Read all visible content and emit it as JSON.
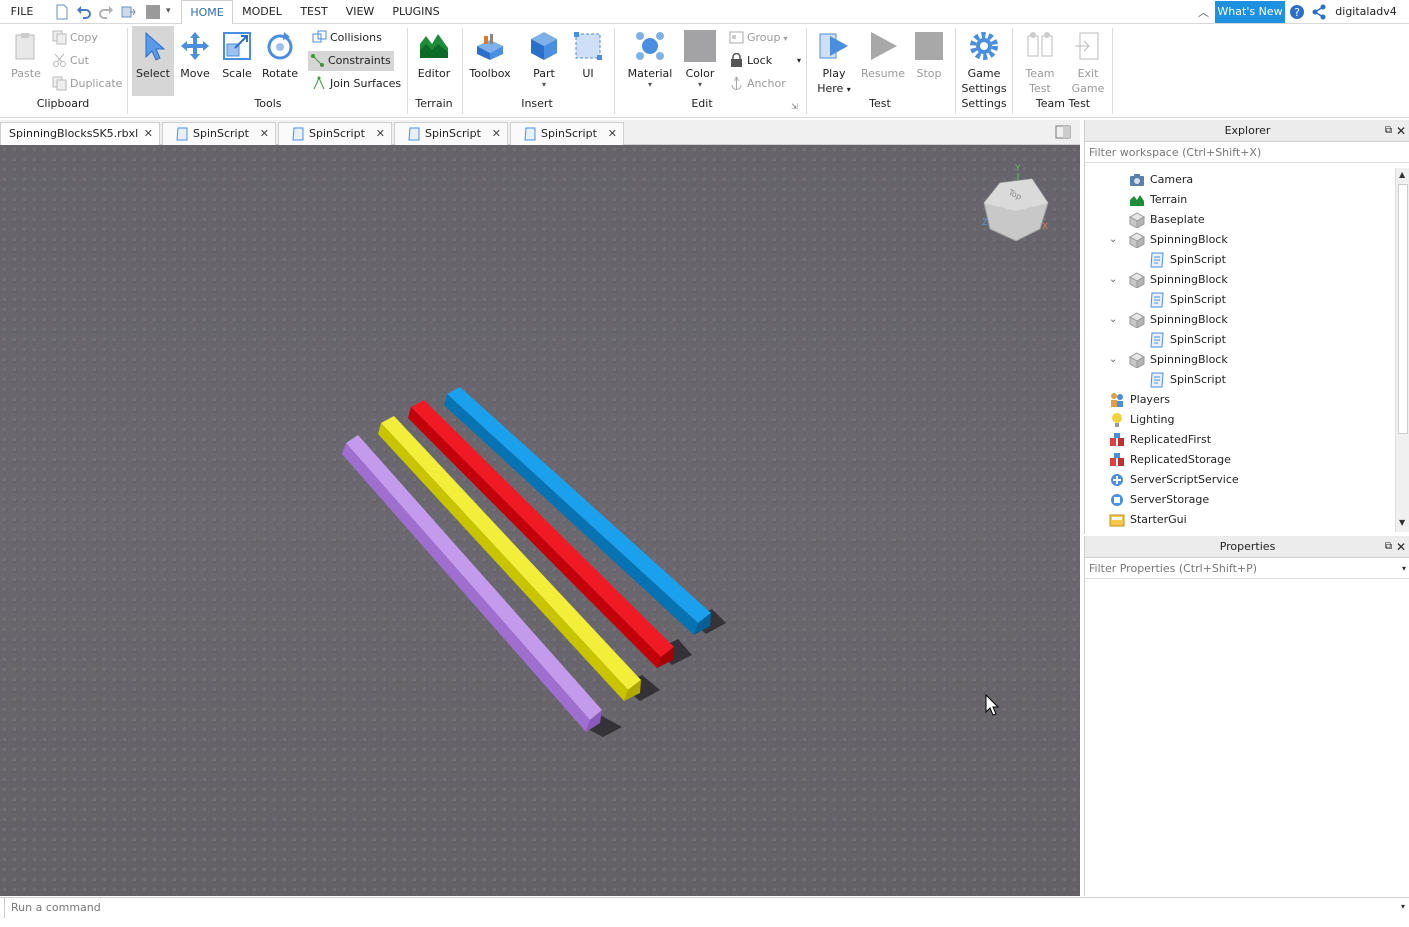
{
  "menubar": {
    "file": "FILE",
    "tabs": [
      "HOME",
      "MODEL",
      "TEST",
      "VIEW",
      "PLUGINS"
    ],
    "whats_new": "What's New",
    "username": "digitaladv4"
  },
  "ribbon": {
    "clipboard": {
      "paste": "Paste",
      "copy": "Copy",
      "cut": "Cut",
      "duplicate": "Duplicate",
      "label": "Clipboard"
    },
    "tools": {
      "select": "Select",
      "move": "Move",
      "scale": "Scale",
      "rotate": "Rotate",
      "collisions": "Collisions",
      "constraints": "Constraints",
      "join_surfaces": "Join Surfaces",
      "label": "Tools"
    },
    "terrain": {
      "editor": "Editor",
      "label": "Terrain"
    },
    "insert": {
      "toolbox": "Toolbox",
      "part": "Part",
      "ui": "UI",
      "label": "Insert"
    },
    "edit": {
      "material": "Material",
      "color": "Color",
      "group": "Group",
      "lock": "Lock",
      "anchor": "Anchor",
      "label": "Edit"
    },
    "test": {
      "play_here_1": "Play",
      "play_here_2": "Here",
      "resume": "Resume",
      "stop": "Stop",
      "label": "Test"
    },
    "settings": {
      "game_settings_1": "Game",
      "game_settings_2": "Settings",
      "label": "Settings"
    },
    "team_test": {
      "team_test_1": "Team",
      "team_test_2": "Test",
      "exit_game_1": "Exit",
      "exit_game_2": "Game",
      "label": "Team Test"
    }
  },
  "doc_tabs": [
    "SpinningBlocksSK5.rbxl",
    "SpinScript",
    "SpinScript",
    "SpinScript",
    "SpinScript"
  ],
  "explorer": {
    "title": "Explorer",
    "filter_placeholder": "Filter workspace (Ctrl+Shift+X)",
    "items": [
      {
        "label": "Camera",
        "icon": "camera-icon"
      },
      {
        "label": "Terrain",
        "icon": "terrain-icon"
      },
      {
        "label": "Baseplate",
        "icon": "part-icon"
      },
      {
        "label": "SpinningBlock",
        "icon": "part-icon"
      },
      {
        "label": "SpinScript",
        "icon": "script-icon"
      },
      {
        "label": "SpinningBlock",
        "icon": "part-icon"
      },
      {
        "label": "SpinScript",
        "icon": "script-icon"
      },
      {
        "label": "SpinningBlock",
        "icon": "part-icon"
      },
      {
        "label": "SpinScript",
        "icon": "script-icon"
      },
      {
        "label": "SpinningBlock",
        "icon": "part-icon"
      },
      {
        "label": "SpinScript",
        "icon": "script-icon"
      },
      {
        "label": "Players",
        "icon": "players-icon"
      },
      {
        "label": "Lighting",
        "icon": "lightbulb-icon"
      },
      {
        "label": "ReplicatedFirst",
        "icon": "replicated-first-icon"
      },
      {
        "label": "ReplicatedStorage",
        "icon": "replicated-storage-icon"
      },
      {
        "label": "ServerScriptService",
        "icon": "server-script-service-icon"
      },
      {
        "label": "ServerStorage",
        "icon": "server-storage-icon"
      },
      {
        "label": "StarterGui",
        "icon": "starter-gui-icon"
      }
    ]
  },
  "properties": {
    "title": "Properties",
    "filter_placeholder": "Filter Properties (Ctrl+Shift+P)"
  },
  "viewport": {
    "blocks": [
      {
        "name": "purple-block",
        "color": "#b88ae0"
      },
      {
        "name": "yellow-block",
        "color": "#e4e000"
      },
      {
        "name": "red-block",
        "color": "#e8000f"
      },
      {
        "name": "blue-block",
        "color": "#0b8fd8"
      }
    ],
    "view_cube_label": "Top",
    "axis_y": "Y",
    "axis_x": "X",
    "axis_z": "Z"
  },
  "command_bar": {
    "placeholder": "Run a command"
  }
}
